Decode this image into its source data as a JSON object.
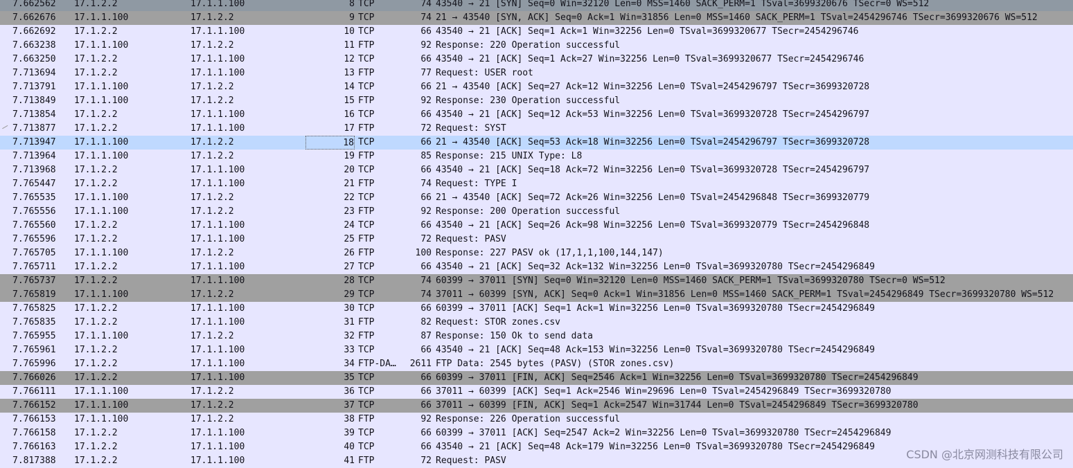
{
  "packets": [
    {
      "time": "7.662562",
      "src": "17.1.2.2",
      "dst": "17.1.1.100",
      "no": "8",
      "proto": "TCP",
      "len": "74",
      "info": "43540 → 21 [SYN] Seq=0 Win=32120 Len=0 MSS=1460 SACK_PERM=1 TSval=3699320676 TSecr=0 WS=512"
    },
    {
      "time": "7.662676",
      "src": "17.1.1.100",
      "dst": "17.1.2.2",
      "no": "9",
      "proto": "TCP",
      "len": "74",
      "info": "21 → 43540 [SYN, ACK] Seq=0 Ack=1 Win=31856 Len=0 MSS=1460 SACK_PERM=1 TSval=2454296746 TSecr=3699320676 WS=512"
    },
    {
      "time": "7.662692",
      "src": "17.1.2.2",
      "dst": "17.1.1.100",
      "no": "10",
      "proto": "TCP",
      "len": "66",
      "info": "43540 → 21 [ACK] Seq=1 Ack=1 Win=32256 Len=0 TSval=3699320677 TSecr=2454296746"
    },
    {
      "time": "7.663238",
      "src": "17.1.1.100",
      "dst": "17.1.2.2",
      "no": "11",
      "proto": "FTP",
      "len": "92",
      "info": "Response: 220 Operation successful"
    },
    {
      "time": "7.663250",
      "src": "17.1.2.2",
      "dst": "17.1.1.100",
      "no": "12",
      "proto": "TCP",
      "len": "66",
      "info": "43540 → 21 [ACK] Seq=1 Ack=27 Win=32256 Len=0 TSval=3699320677 TSecr=2454296746"
    },
    {
      "time": "7.713694",
      "src": "17.1.2.2",
      "dst": "17.1.1.100",
      "no": "13",
      "proto": "FTP",
      "len": "77",
      "info": "Request: USER root"
    },
    {
      "time": "7.713791",
      "src": "17.1.1.100",
      "dst": "17.1.2.2",
      "no": "14",
      "proto": "TCP",
      "len": "66",
      "info": "21 → 43540 [ACK] Seq=27 Ack=12 Win=32256 Len=0 TSval=2454296797 TSecr=3699320728"
    },
    {
      "time": "7.713849",
      "src": "17.1.1.100",
      "dst": "17.1.2.2",
      "no": "15",
      "proto": "FTP",
      "len": "92",
      "info": "Response: 230 Operation successful"
    },
    {
      "time": "7.713854",
      "src": "17.1.2.2",
      "dst": "17.1.1.100",
      "no": "16",
      "proto": "TCP",
      "len": "66",
      "info": "43540 → 21 [ACK] Seq=12 Ack=53 Win=32256 Len=0 TSval=3699320728 TSecr=2454296797"
    },
    {
      "time": "7.713877",
      "src": "17.1.2.2",
      "dst": "17.1.1.100",
      "no": "17",
      "proto": "FTP",
      "len": "72",
      "info": "Request: SYST"
    },
    {
      "time": "7.713947",
      "src": "17.1.1.100",
      "dst": "17.1.2.2",
      "no": "18",
      "proto": "TCP",
      "len": "66",
      "info": "21 → 43540 [ACK] Seq=53 Ack=18 Win=32256 Len=0 TSval=2454296797 TSecr=3699320728"
    },
    {
      "time": "7.713964",
      "src": "17.1.1.100",
      "dst": "17.1.2.2",
      "no": "19",
      "proto": "FTP",
      "len": "85",
      "info": "Response: 215 UNIX Type: L8"
    },
    {
      "time": "7.713968",
      "src": "17.1.2.2",
      "dst": "17.1.1.100",
      "no": "20",
      "proto": "TCP",
      "len": "66",
      "info": "43540 → 21 [ACK] Seq=18 Ack=72 Win=32256 Len=0 TSval=3699320728 TSecr=2454296797"
    },
    {
      "time": "7.765447",
      "src": "17.1.2.2",
      "dst": "17.1.1.100",
      "no": "21",
      "proto": "FTP",
      "len": "74",
      "info": "Request: TYPE I"
    },
    {
      "time": "7.765535",
      "src": "17.1.1.100",
      "dst": "17.1.2.2",
      "no": "22",
      "proto": "TCP",
      "len": "66",
      "info": "21 → 43540 [ACK] Seq=72 Ack=26 Win=32256 Len=0 TSval=2454296848 TSecr=3699320779"
    },
    {
      "time": "7.765556",
      "src": "17.1.1.100",
      "dst": "17.1.2.2",
      "no": "23",
      "proto": "FTP",
      "len": "92",
      "info": "Response: 200 Operation successful"
    },
    {
      "time": "7.765560",
      "src": "17.1.2.2",
      "dst": "17.1.1.100",
      "no": "24",
      "proto": "TCP",
      "len": "66",
      "info": "43540 → 21 [ACK] Seq=26 Ack=98 Win=32256 Len=0 TSval=3699320779 TSecr=2454296848"
    },
    {
      "time": "7.765596",
      "src": "17.1.2.2",
      "dst": "17.1.1.100",
      "no": "25",
      "proto": "FTP",
      "len": "72",
      "info": "Request: PASV"
    },
    {
      "time": "7.765705",
      "src": "17.1.1.100",
      "dst": "17.1.2.2",
      "no": "26",
      "proto": "FTP",
      "len": "100",
      "info": "Response: 227 PASV ok (17,1,1,100,144,147)"
    },
    {
      "time": "7.765711",
      "src": "17.1.2.2",
      "dst": "17.1.1.100",
      "no": "27",
      "proto": "TCP",
      "len": "66",
      "info": "43540 → 21 [ACK] Seq=32 Ack=132 Win=32256 Len=0 TSval=3699320780 TSecr=2454296849"
    },
    {
      "time": "7.765737",
      "src": "17.1.2.2",
      "dst": "17.1.1.100",
      "no": "28",
      "proto": "TCP",
      "len": "74",
      "info": "60399 → 37011 [SYN] Seq=0 Win=32120 Len=0 MSS=1460 SACK_PERM=1 TSval=3699320780 TSecr=0 WS=512"
    },
    {
      "time": "7.765819",
      "src": "17.1.1.100",
      "dst": "17.1.2.2",
      "no": "29",
      "proto": "TCP",
      "len": "74",
      "info": "37011 → 60399 [SYN, ACK] Seq=0 Ack=1 Win=31856 Len=0 MSS=1460 SACK_PERM=1 TSval=2454296849 TSecr=3699320780 WS=512"
    },
    {
      "time": "7.765825",
      "src": "17.1.2.2",
      "dst": "17.1.1.100",
      "no": "30",
      "proto": "TCP",
      "len": "66",
      "info": "60399 → 37011 [ACK] Seq=1 Ack=1 Win=32256 Len=0 TSval=3699320780 TSecr=2454296849"
    },
    {
      "time": "7.765835",
      "src": "17.1.2.2",
      "dst": "17.1.1.100",
      "no": "31",
      "proto": "FTP",
      "len": "82",
      "info": "Request: STOR zones.csv"
    },
    {
      "time": "7.765955",
      "src": "17.1.1.100",
      "dst": "17.1.2.2",
      "no": "32",
      "proto": "FTP",
      "len": "87",
      "info": "Response: 150 Ok to send data"
    },
    {
      "time": "7.765961",
      "src": "17.1.2.2",
      "dst": "17.1.1.100",
      "no": "33",
      "proto": "TCP",
      "len": "66",
      "info": "43540 → 21 [ACK] Seq=48 Ack=153 Win=32256 Len=0 TSval=3699320780 TSecr=2454296849"
    },
    {
      "time": "7.765996",
      "src": "17.1.2.2",
      "dst": "17.1.1.100",
      "no": "34",
      "proto": "FTP-DA…",
      "len": "2611",
      "info": "FTP Data: 2545 bytes (PASV) (STOR zones.csv)"
    },
    {
      "time": "7.766026",
      "src": "17.1.2.2",
      "dst": "17.1.1.100",
      "no": "35",
      "proto": "TCP",
      "len": "66",
      "info": "60399 → 37011 [FIN, ACK] Seq=2546 Ack=1 Win=32256 Len=0 TSval=3699320780 TSecr=2454296849"
    },
    {
      "time": "7.766111",
      "src": "17.1.1.100",
      "dst": "17.1.2.2",
      "no": "36",
      "proto": "TCP",
      "len": "66",
      "info": "37011 → 60399 [ACK] Seq=1 Ack=2546 Win=29696 Len=0 TSval=2454296849 TSecr=3699320780"
    },
    {
      "time": "7.766152",
      "src": "17.1.1.100",
      "dst": "17.1.2.2",
      "no": "37",
      "proto": "TCP",
      "len": "66",
      "info": "37011 → 60399 [FIN, ACK] Seq=1 Ack=2547 Win=31744 Len=0 TSval=2454296849 TSecr=3699320780"
    },
    {
      "time": "7.766153",
      "src": "17.1.1.100",
      "dst": "17.1.2.2",
      "no": "38",
      "proto": "FTP",
      "len": "92",
      "info": "Response: 226 Operation successful"
    },
    {
      "time": "7.766158",
      "src": "17.1.2.2",
      "dst": "17.1.1.100",
      "no": "39",
      "proto": "TCP",
      "len": "66",
      "info": "60399 → 37011 [ACK] Seq=2547 Ack=2 Win=32256 Len=0 TSval=3699320780 TSecr=2454296849"
    },
    {
      "time": "7.766163",
      "src": "17.1.2.2",
      "dst": "17.1.1.100",
      "no": "40",
      "proto": "TCP",
      "len": "66",
      "info": "43540 → 21 [ACK] Seq=48 Ack=179 Win=32256 Len=0 TSval=3699320780 TSecr=2454296849"
    },
    {
      "time": "7.817388",
      "src": "17.1.2.2",
      "dst": "17.1.1.100",
      "no": "41",
      "proto": "FTP",
      "len": "72",
      "info": "Request: PASV"
    }
  ],
  "watermark": "CSDN @北京网测科技有限公司",
  "colors": {
    "background": "#e7e6ff",
    "syn_row": "#a0a0a0",
    "selected_row": "#bfd9ff"
  },
  "selected_no": "18"
}
